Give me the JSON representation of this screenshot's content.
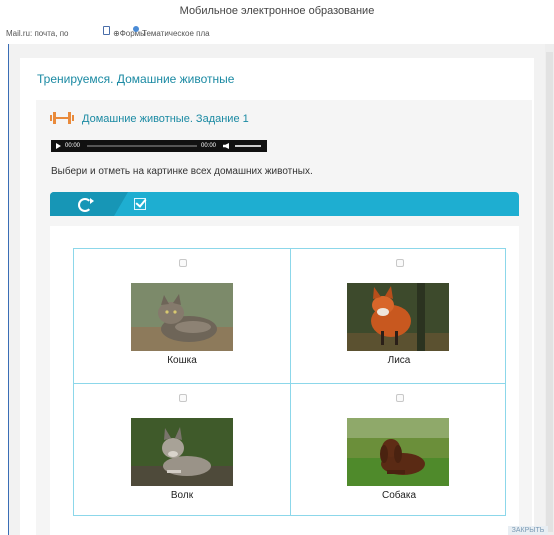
{
  "window": {
    "title": "Мобильное электронное образование"
  },
  "bookmarks": [
    {
      "label": "Mail.ru: почта, по"
    },
    {
      "label": "Формы"
    },
    {
      "label": "Тематическое пла"
    }
  ],
  "page": {
    "title": "Тренируемся. Домашние животные"
  },
  "task": {
    "title": "Домашние животные. Задание 1",
    "instruction": "Выбери и отметь на картинке всех домашних животных."
  },
  "audio": {
    "current_time": "00:00",
    "duration": "00:00"
  },
  "toolbar": {
    "refresh_icon": "refresh-icon",
    "check_icon": "check-icon"
  },
  "answers": [
    {
      "label": "Кошка",
      "checked": false
    },
    {
      "label": "Лиса",
      "checked": false
    },
    {
      "label": "Волк",
      "checked": false
    },
    {
      "label": "Собака",
      "checked": false
    }
  ],
  "footer": {
    "close_label": "ЗАКРЫТЬ"
  },
  "colors": {
    "accent": "#1b8aa3",
    "toolbar": "#1eaed1",
    "grid": "#8cd7ea",
    "icon": "#e98a3b"
  }
}
